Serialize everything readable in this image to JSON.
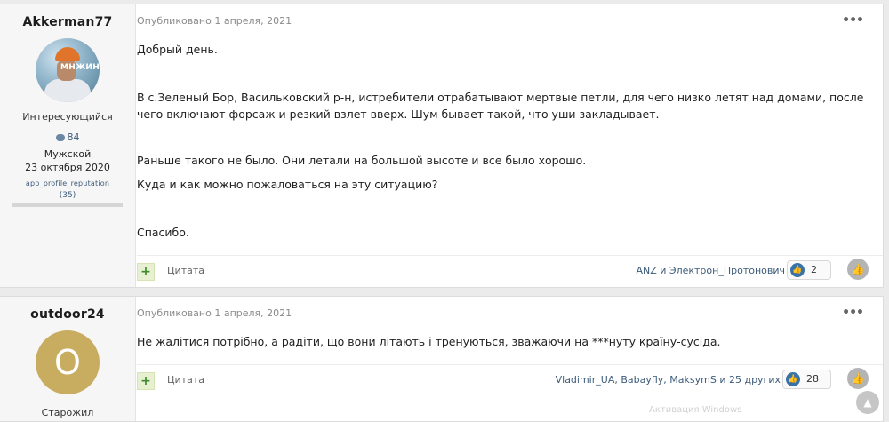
{
  "posts": [
    {
      "author": {
        "username": "Akkerman77",
        "avatar_watermark": "МНЖИНЕ",
        "rank": "Интересующийся",
        "posts_count": "84",
        "gender": "Мужской",
        "joined": "23 октября 2020",
        "reputation_label": "app_profile_reputation",
        "reputation_value": "(35)"
      },
      "date": "Опубликовано 1 апреля, 2021",
      "paragraphs": [
        "Добрый день.",
        "В с.Зеленый Бор, Васильковский р-н, истребители отрабатывают мертвые петли, для чего низко летят над домами, после чего включают форсаж и резкий взлет вверх. Шум бывает такой, что уши закладывает.",
        "Раньше такого не было. Они летали на большой высоте и все было хорошо.",
        "Куда и как можно пожаловаться на эту ситуацию?",
        "Спасибо."
      ],
      "footer": {
        "quote_label": "Цитата",
        "reactors": "ANZ и Электрон_Протонович",
        "reaction_count": "2"
      }
    },
    {
      "author": {
        "username": "outdoor24",
        "avatar_letter": "O",
        "rank": "Старожил"
      },
      "date": "Опубликовано 1 апреля, 2021",
      "paragraphs": [
        "Не жалітися потрібно, а радіти, що вони літають і тренуються, зважаючи на ***нуту країну-сусіда."
      ],
      "footer": {
        "quote_label": "Цитата",
        "reactors": "Vladimir_UA, Babayfly, MaksymS и 25 других",
        "reaction_count": "28"
      }
    }
  ],
  "icons": {
    "more": "ellipsis-icon",
    "add": "plus-icon",
    "reaction": "thumbs-up-icon",
    "posts": "comment-icon",
    "scroll_top": "chevron-up-icon"
  },
  "windows_watermark": "Активация Windows",
  "colors": {
    "link": "#3e5c7b",
    "reaction_badge": "#3873a8",
    "avatar_o": "#c8ac5f",
    "plus_green": "#3b8b2c"
  }
}
